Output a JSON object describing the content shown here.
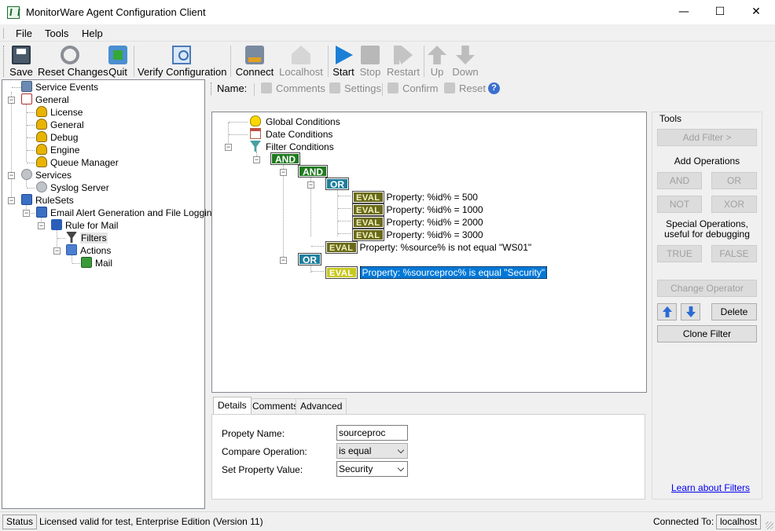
{
  "window": {
    "title": "MonitorWare Agent Configuration Client",
    "minimize": "—",
    "maximize": "☐",
    "close": "✕"
  },
  "menu": [
    "File",
    "Tools",
    "Help"
  ],
  "toolbar": {
    "save": "Save",
    "reset_changes": "Reset Changes",
    "quit": "Quit",
    "verify_configuration": "Verify Configuration",
    "connect": "Connect",
    "localhost": "Localhost",
    "start": "Start",
    "stop": "Stop",
    "restart": "Restart",
    "up": "Up",
    "down": "Down"
  },
  "nav_tree": {
    "service_events": "Service Events",
    "general": "General",
    "license": "License",
    "general_child": "General",
    "debug": "Debug",
    "engine": "Engine",
    "queue_manager": "Queue Manager",
    "services": "Services",
    "syslog_server": "Syslog Server",
    "rulesets": "RuleSets",
    "ruleset_email": "Email Alert Generation and File Logging",
    "rule_for_mail": "Rule for Mail",
    "filters": "Filters",
    "actions": "Actions",
    "mail": "Mail"
  },
  "ruleset_bar": {
    "name_label": "Name:",
    "comments": "Comments",
    "settings": "Settings",
    "confirm": "Confirm",
    "reset": "Reset",
    "help": "?"
  },
  "filter_tree": {
    "global_conditions": "Global Conditions",
    "date_conditions": "Date Conditions",
    "filter_conditions": "Filter Conditions",
    "and_root": "AND",
    "and_child": "AND",
    "or_child": "OR",
    "eval": "EVAL",
    "eval1": "Property: %id% = 500",
    "eval2": "Property: %id% = 1000",
    "eval3": "Property: %id% = 2000",
    "eval4": "Property: %id% = 3000",
    "eval5": "Property: %source% is not equal \"WS01\"",
    "or_second": "OR",
    "eval6": "Property: %sourceproc% is equal \"Security\""
  },
  "details": {
    "tabs": [
      "Details",
      "Comments",
      "Advanced"
    ],
    "property_name_label": "Propety Name:",
    "property_name_value": "sourceproc",
    "compare_operation_label": "Compare Operation:",
    "compare_operation_value": "is equal",
    "set_property_value_label": "Set Property Value:",
    "set_property_value_value": "Security"
  },
  "tools": {
    "title": "Tools",
    "add_filter": "Add Filter >",
    "add_operations": "Add Operations",
    "and": "AND",
    "or": "OR",
    "not": "NOT",
    "xor": "XOR",
    "special_ops_line1": "Special Operations,",
    "special_ops_line2": "useful for debugging",
    "true": "TRUE",
    "false": "FALSE",
    "change_operator": "Change Operator",
    "delete": "Delete",
    "clone_filter": "Clone Filter",
    "learn_link": "Learn about Filters"
  },
  "status": {
    "status_label": "Status",
    "license_text": "Licensed valid for test, Enterprise Edition (Version 11)",
    "connected_to_label": "Connected To:",
    "connected_host": "localhost"
  },
  "colors": {
    "and_badge": "#1f7a1f",
    "or_badge": "#1d7f9d",
    "eval_badge": "#6a6a1a",
    "selection": "#0078d7"
  }
}
